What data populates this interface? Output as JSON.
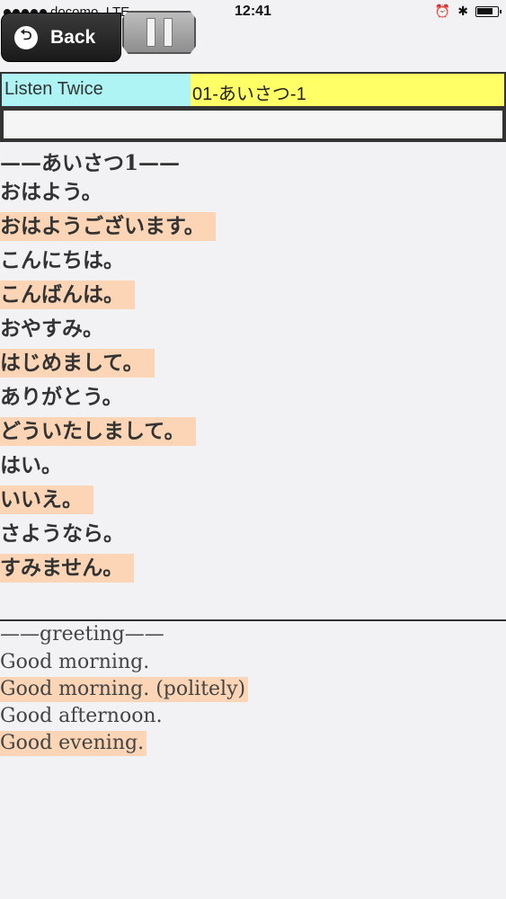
{
  "status_bar": {
    "carrier": "docomo",
    "network": "LTE",
    "time": "12:41",
    "alarm_icon": "⏰",
    "bluetooth_icon": "✱"
  },
  "toolbar": {
    "back_label": "Back",
    "back_icon": "⮌"
  },
  "info_bar": {
    "mode": "Listen Twice",
    "lesson": "01-あいさつ-1"
  },
  "input": {
    "value": ""
  },
  "japanese": {
    "title": "——あいさつ1——",
    "lines": [
      {
        "text": "おはよう。",
        "highlighted": false
      },
      {
        "text": "おはようございます。",
        "highlighted": true
      },
      {
        "text": "こんにちは。",
        "highlighted": false
      },
      {
        "text": "こんばんは。",
        "highlighted": true
      },
      {
        "text": "おやすみ。",
        "highlighted": false
      },
      {
        "text": "はじめまして。",
        "highlighted": true
      },
      {
        "text": "ありがとう。",
        "highlighted": false
      },
      {
        "text": "どういたしまして。",
        "highlighted": true
      },
      {
        "text": "はい。",
        "highlighted": false
      },
      {
        "text": "いいえ。",
        "highlighted": true
      },
      {
        "text": "さようなら。",
        "highlighted": false
      },
      {
        "text": "すみません。",
        "highlighted": true
      }
    ]
  },
  "english": {
    "title": "——greeting——",
    "lines": [
      {
        "text": "Good morning.",
        "highlighted": false
      },
      {
        "text": "Good morning. (politely)",
        "highlighted": true
      },
      {
        "text": "Good afternoon.",
        "highlighted": false
      },
      {
        "text": "Good evening.",
        "highlighted": true
      }
    ]
  },
  "colors": {
    "highlight": "#fbd5b5",
    "mode_bg": "#aef4f4",
    "lesson_bg": "#ffff66"
  }
}
